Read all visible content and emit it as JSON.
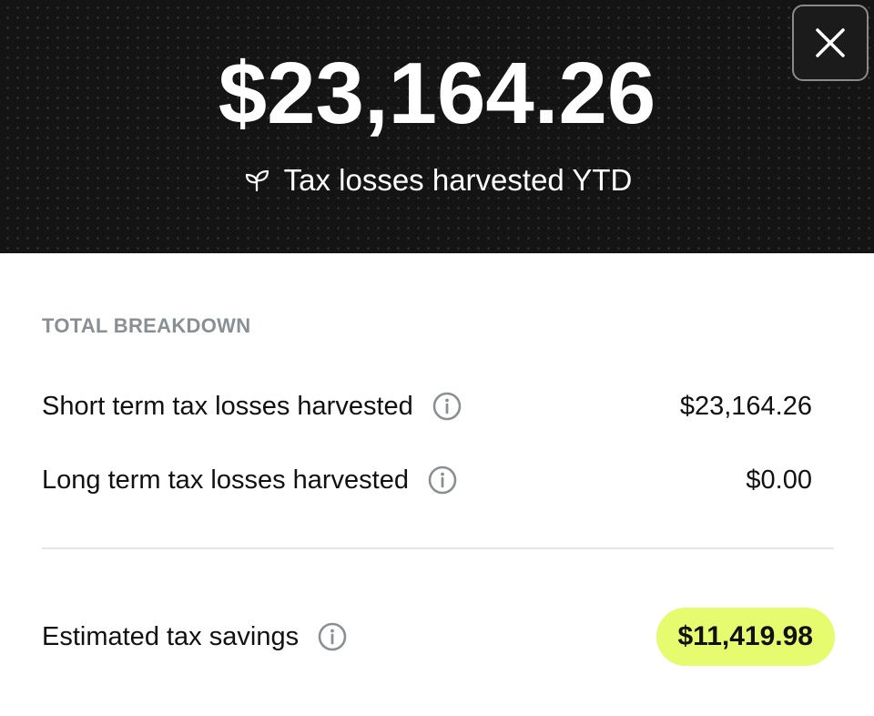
{
  "hero": {
    "amount": "$23,164.26",
    "caption": "Tax losses harvested YTD",
    "caption_icon": "sprout-icon",
    "close_icon": "close-icon"
  },
  "breakdown": {
    "title": "TOTAL BREAKDOWN",
    "rows": [
      {
        "label": "Short term tax losses harvested",
        "value": "$23,164.26",
        "icon": "info-icon"
      },
      {
        "label": "Long term tax losses harvested",
        "value": "$0.00",
        "icon": "info-icon"
      }
    ]
  },
  "savings": {
    "label": "Estimated tax savings",
    "value": "$11,419.98",
    "icon": "info-icon"
  },
  "colors": {
    "hero_background": "#141414",
    "savings_badge": "#e6fb6e",
    "section_title": "#8a8f93"
  }
}
